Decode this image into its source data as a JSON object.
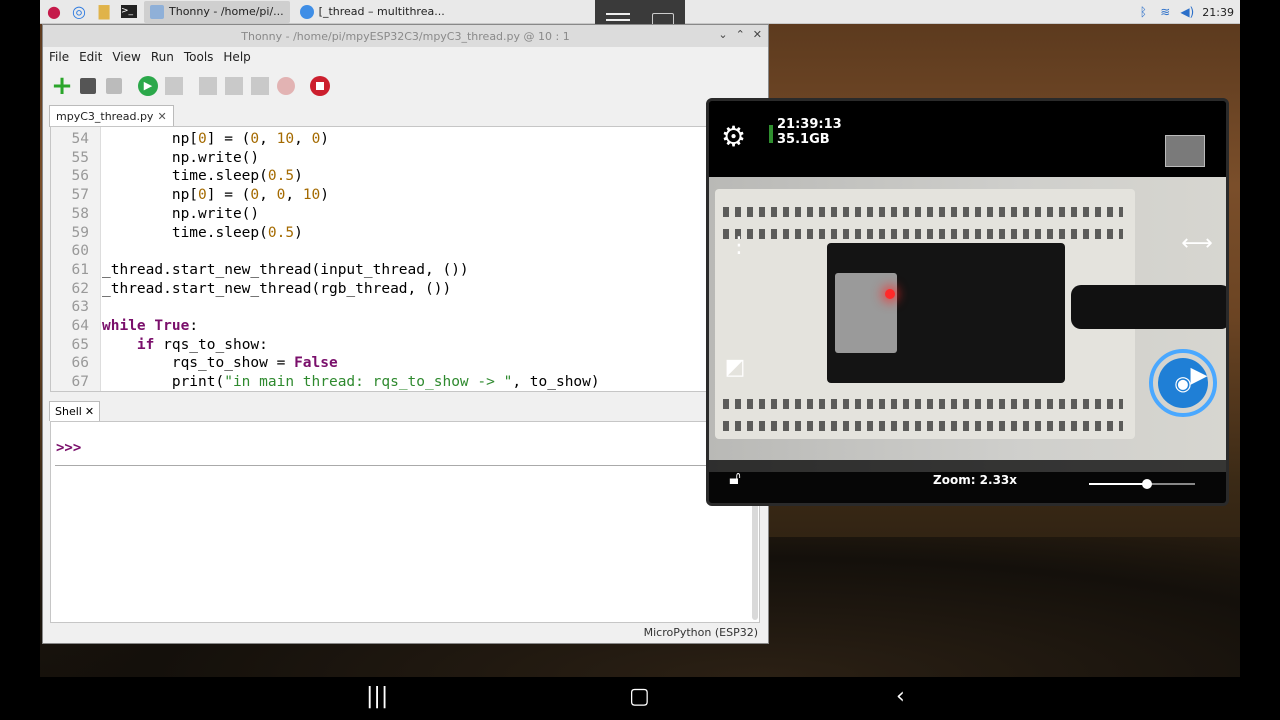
{
  "taskbar": {
    "tasks": [
      {
        "label": "Thonny  -  /home/pi/...",
        "active": true
      },
      {
        "label": "[_thread – multithrea...",
        "active": false
      }
    ],
    "clock": "21:39"
  },
  "thonny": {
    "title": "Thonny  -  /home/pi/mpyESP32C3/mpyC3_thread.py  @  10 : 1",
    "menu": [
      "File",
      "Edit",
      "View",
      "Run",
      "Tools",
      "Help"
    ],
    "editor_tab": "mpyC3_thread.py",
    "shell_tab": "Shell",
    "shell_prompt": ">>>",
    "status": "MicroPython (ESP32)",
    "lines": [
      {
        "n": "54",
        "html": "        np[<span class='num'>0</span>] = (<span class='num'>0</span>, <span class='num'>10</span>, <span class='num'>0</span>)"
      },
      {
        "n": "55",
        "html": "        np.write()"
      },
      {
        "n": "56",
        "html": "        time.sleep(<span class='num'>0.5</span>)"
      },
      {
        "n": "57",
        "html": "        np[<span class='num'>0</span>] = (<span class='num'>0</span>, <span class='num'>0</span>, <span class='num'>10</span>)"
      },
      {
        "n": "58",
        "html": "        np.write()"
      },
      {
        "n": "59",
        "html": "        time.sleep(<span class='num'>0.5</span>)"
      },
      {
        "n": "60",
        "html": ""
      },
      {
        "n": "61",
        "html": "_thread.start_new_thread(input_thread, ())"
      },
      {
        "n": "62",
        "html": "_thread.start_new_thread(rgb_thread, ())"
      },
      {
        "n": "63",
        "html": ""
      },
      {
        "n": "64",
        "html": "<span class='kw'>while</span> <span class='kw'>True</span>:"
      },
      {
        "n": "65",
        "html": "    <span class='kw'>if</span> rqs_to_show:"
      },
      {
        "n": "66",
        "html": "        rqs_to_show = <span class='kw'>False</span>"
      },
      {
        "n": "67",
        "html": "        print(<span class='str'>\"in main thread: rqs_to_show -> \"</span>, to_show)"
      }
    ]
  },
  "camera": {
    "time": "21:39:13",
    "storage": "35.1GB",
    "zoom_label": "Zoom: 2.33x",
    "zoom_level": 0.55
  }
}
